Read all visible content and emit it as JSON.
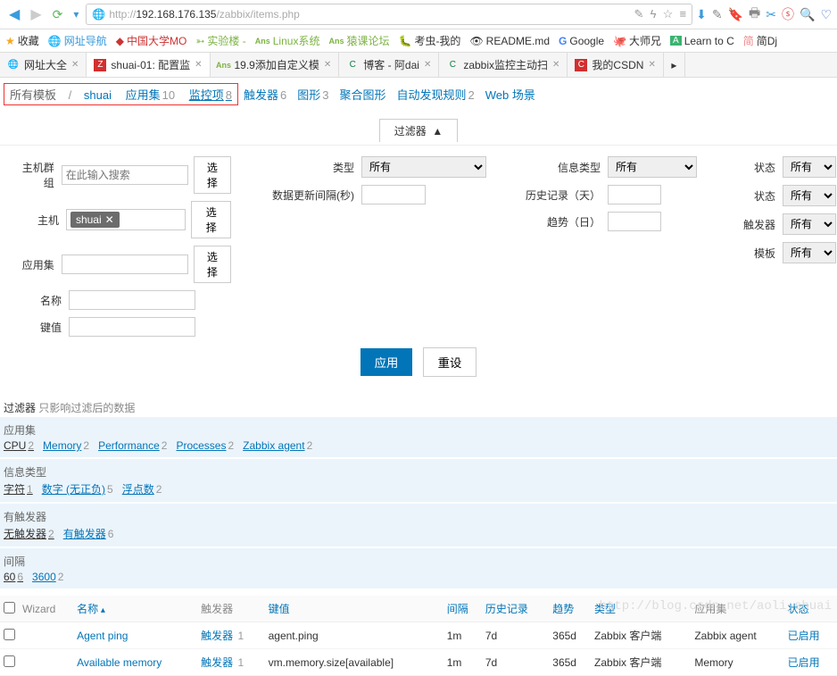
{
  "url": {
    "scheme": "http://",
    "host": "192.168.176.135",
    "path": "/zabbix/items.php"
  },
  "bookmarks": [
    {
      "label": "收藏"
    },
    {
      "label": "网址导航"
    },
    {
      "label": "中国大学MO"
    },
    {
      "label": "实验楼 -"
    },
    {
      "label": "Linux系统"
    },
    {
      "label": "猿课论坛"
    },
    {
      "label": "考虫-我的"
    },
    {
      "label": "README.md"
    },
    {
      "label": "Google"
    },
    {
      "label": "大师兄"
    },
    {
      "label": "Learn to C"
    },
    {
      "label": "简Dj"
    }
  ],
  "tabs": [
    {
      "label": "网址大全"
    },
    {
      "label": "shuai-01: 配置监",
      "active": true
    },
    {
      "label": "19.9添加自定义模"
    },
    {
      "label": "博客 - 阿dai"
    },
    {
      "label": "zabbix监控主动扫"
    },
    {
      "label": "我的CSDN"
    }
  ],
  "subnav": {
    "prefix": "所有模板",
    "bc": "shuai",
    "items": [
      {
        "label": "应用集",
        "count": "10"
      },
      {
        "label": "监控项",
        "count": "8",
        "underline": true
      },
      {
        "label": "触发器",
        "count": "6"
      },
      {
        "label": "图形",
        "count": "3"
      },
      {
        "label": "聚合图形"
      },
      {
        "label": "自动发现规则",
        "count": "2"
      },
      {
        "label": "Web 场景"
      }
    ]
  },
  "filter": {
    "title": "过滤器",
    "hostgroup_label": "主机群组",
    "hostgroup_placeholder": "在此输入搜索",
    "select_btn": "选择",
    "host_label": "主机",
    "host_chip": "shuai",
    "appset_label": "应用集",
    "name_label": "名称",
    "key_label": "键值",
    "type_label": "类型",
    "type_val": "所有",
    "update_label": "数据更新间隔(秒)",
    "infotype_label": "信息类型",
    "infotype_val": "所有",
    "history_label": "历史记录（天）",
    "trend_label": "趋势（日）",
    "state1_label": "状态",
    "state1_val": "所有",
    "state2_label": "状态",
    "state2_val": "所有",
    "trigger_label": "触发器",
    "trigger_val": "所有",
    "template_label": "模板",
    "template_val": "所有",
    "apply": "应用",
    "reset": "重设"
  },
  "post_title": "过滤器",
  "post_note": "只影响过滤后的数据",
  "cats": {
    "appset": {
      "label": "应用集",
      "items": [
        {
          "label": "CPU",
          "count": "2",
          "sel": true
        },
        {
          "label": "Memory",
          "count": "2"
        },
        {
          "label": "Performance",
          "count": "2"
        },
        {
          "label": "Processes",
          "count": "2"
        },
        {
          "label": "Zabbix agent",
          "count": "2"
        }
      ]
    },
    "infotype": {
      "label": "信息类型",
      "items": [
        {
          "label": "字符",
          "count": "1",
          "sel": true
        },
        {
          "label": "数字 (无正负)",
          "count": "5"
        },
        {
          "label": "浮点数",
          "count": "2"
        }
      ]
    },
    "trigger": {
      "label": "有触发器",
      "items": [
        {
          "label": "无触发器",
          "count": "2",
          "sel": true
        },
        {
          "label": "有触发器",
          "count": "6"
        }
      ]
    },
    "interval": {
      "label": "间隔",
      "items": [
        {
          "label": "60",
          "count": "6",
          "sel": true
        },
        {
          "label": "3600",
          "count": "2"
        }
      ]
    }
  },
  "tbl": {
    "headers": {
      "wizard": "Wizard",
      "name": "名称",
      "trigger": "触发器",
      "key": "键值",
      "interval": "间隔",
      "history": "历史记录",
      "trend": "趋势",
      "type": "类型",
      "app": "应用集",
      "status": "状态"
    },
    "rows": [
      {
        "name": "Agent ping",
        "trigger": "触发器",
        "tcount": "1",
        "key": "agent.ping",
        "interval": "1m",
        "history": "7d",
        "trend": "365d",
        "type": "Zabbix 客户端",
        "app": "Zabbix agent",
        "status": "已启用"
      },
      {
        "name": "Available memory",
        "trigger": "触发器",
        "tcount": "1",
        "key": "vm.memory.size[available]",
        "interval": "1m",
        "history": "7d",
        "trend": "365d",
        "type": "Zabbix 客户端",
        "app": "Memory",
        "status": "已启用"
      }
    ]
  },
  "watermark": "http://blog.csdn.net/aoli_shuai"
}
